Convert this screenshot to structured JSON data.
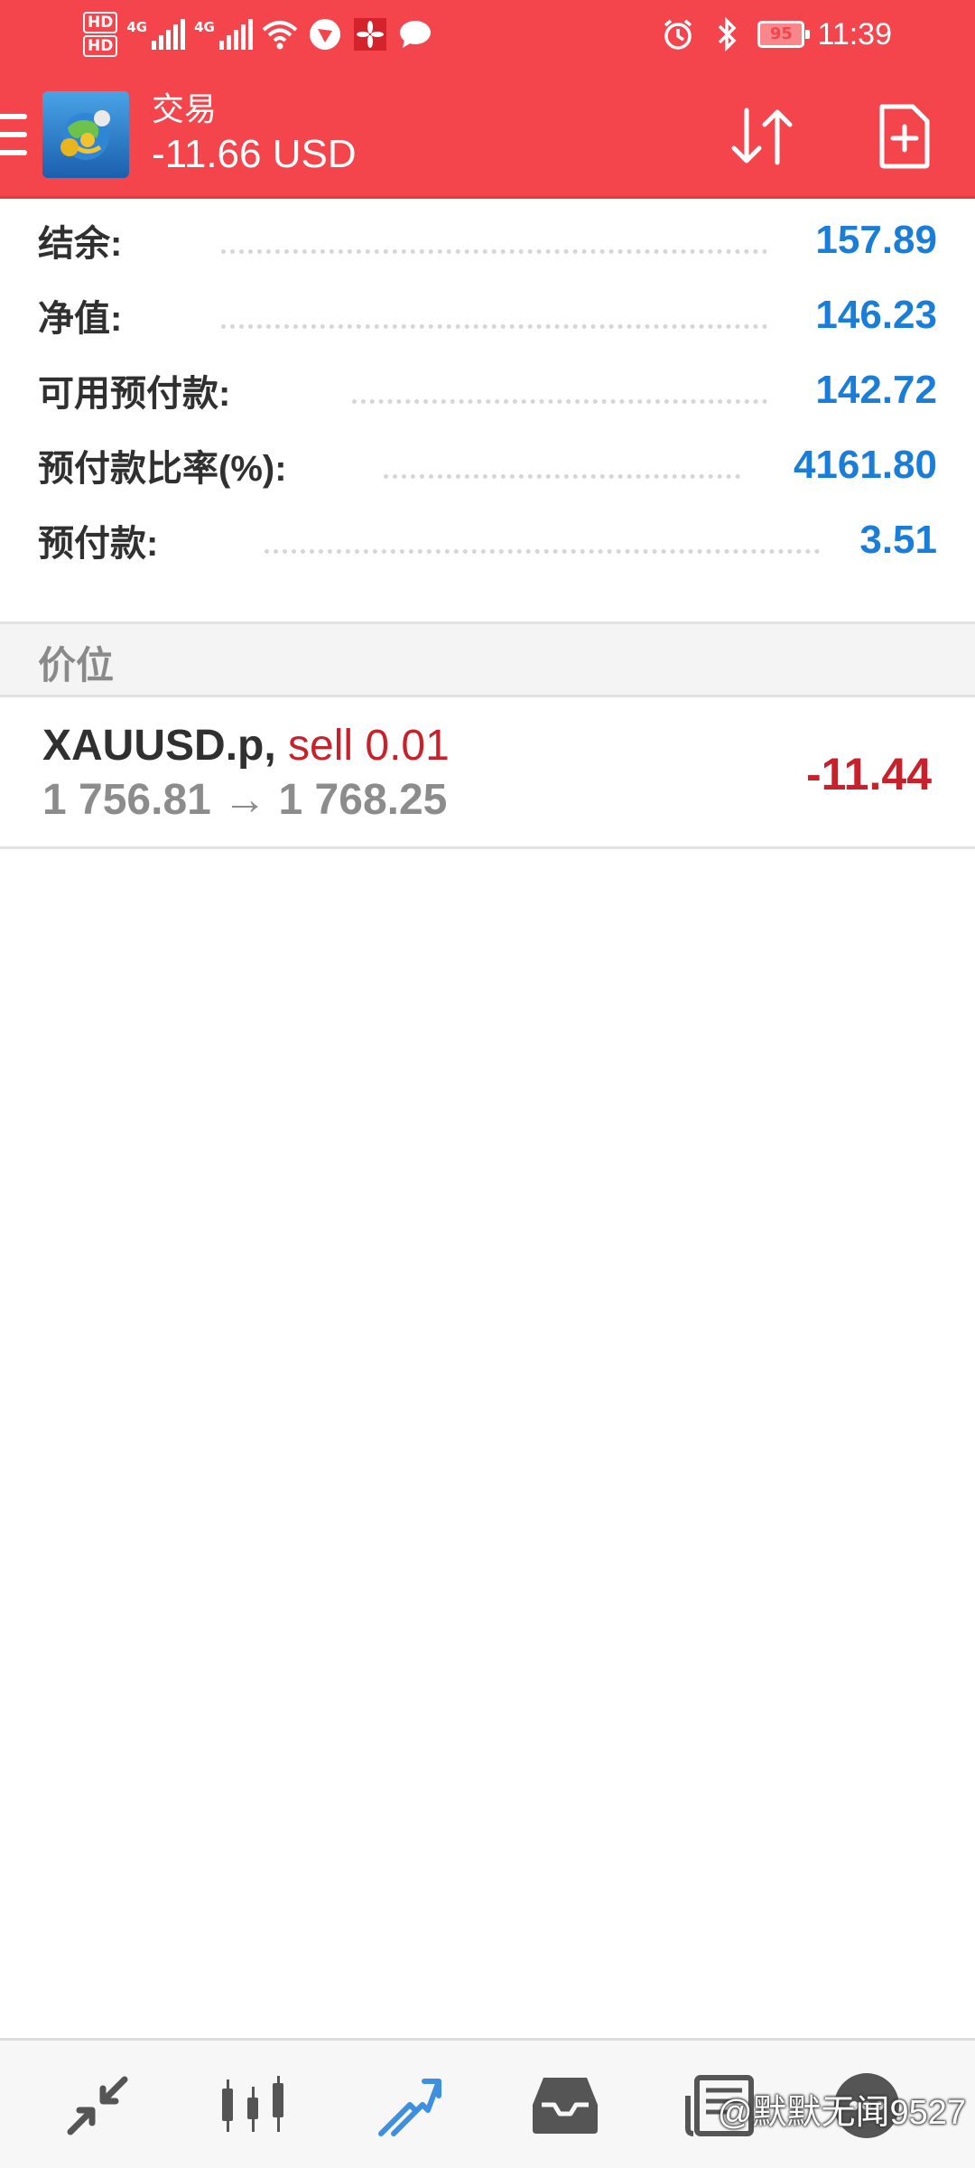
{
  "status_bar": {
    "hd1": "HD",
    "hd2": "HD",
    "signal1_label": "4G",
    "signal2_label": "4G",
    "battery": "95",
    "time": "11:39",
    "icons": [
      "wifi-icon",
      "app-notification-icon",
      "huawei-icon",
      "chat-icon",
      "alarm-icon",
      "bluetooth-icon"
    ]
  },
  "toolbar": {
    "title": "交易",
    "balance_change": "-11.66 USD",
    "icons": [
      "menu-icon",
      "metatrader-logo",
      "sort-icon",
      "new-order-icon"
    ]
  },
  "account": {
    "rows": [
      {
        "label": "结余:",
        "value": "157.89"
      },
      {
        "label": "净值:",
        "value": "146.23"
      },
      {
        "label": "可用预付款:",
        "value": "142.72"
      },
      {
        "label": "预付款比率(%):",
        "value": "4161.80"
      },
      {
        "label": "预付款:",
        "value": "3.51"
      }
    ]
  },
  "section": {
    "title": "价位"
  },
  "position": {
    "symbol": "XAUUSD.p,",
    "type": "sell 0.01",
    "prices": "1 756.81 → 1 768.25",
    "profit": "-11.44"
  },
  "bottom_nav": {
    "items": [
      "quotes-icon",
      "chart-icon",
      "trade-icon",
      "history-icon",
      "news-icon",
      "messages-icon"
    ],
    "active": "trade-icon",
    "watermark": "@默默无闻9527"
  },
  "colors": {
    "header": "#f4454d",
    "value_blue": "#1a7ed8",
    "loss_red": "#c8212b",
    "nav_active": "#3d8fe0",
    "nav_inactive": "#555555"
  }
}
